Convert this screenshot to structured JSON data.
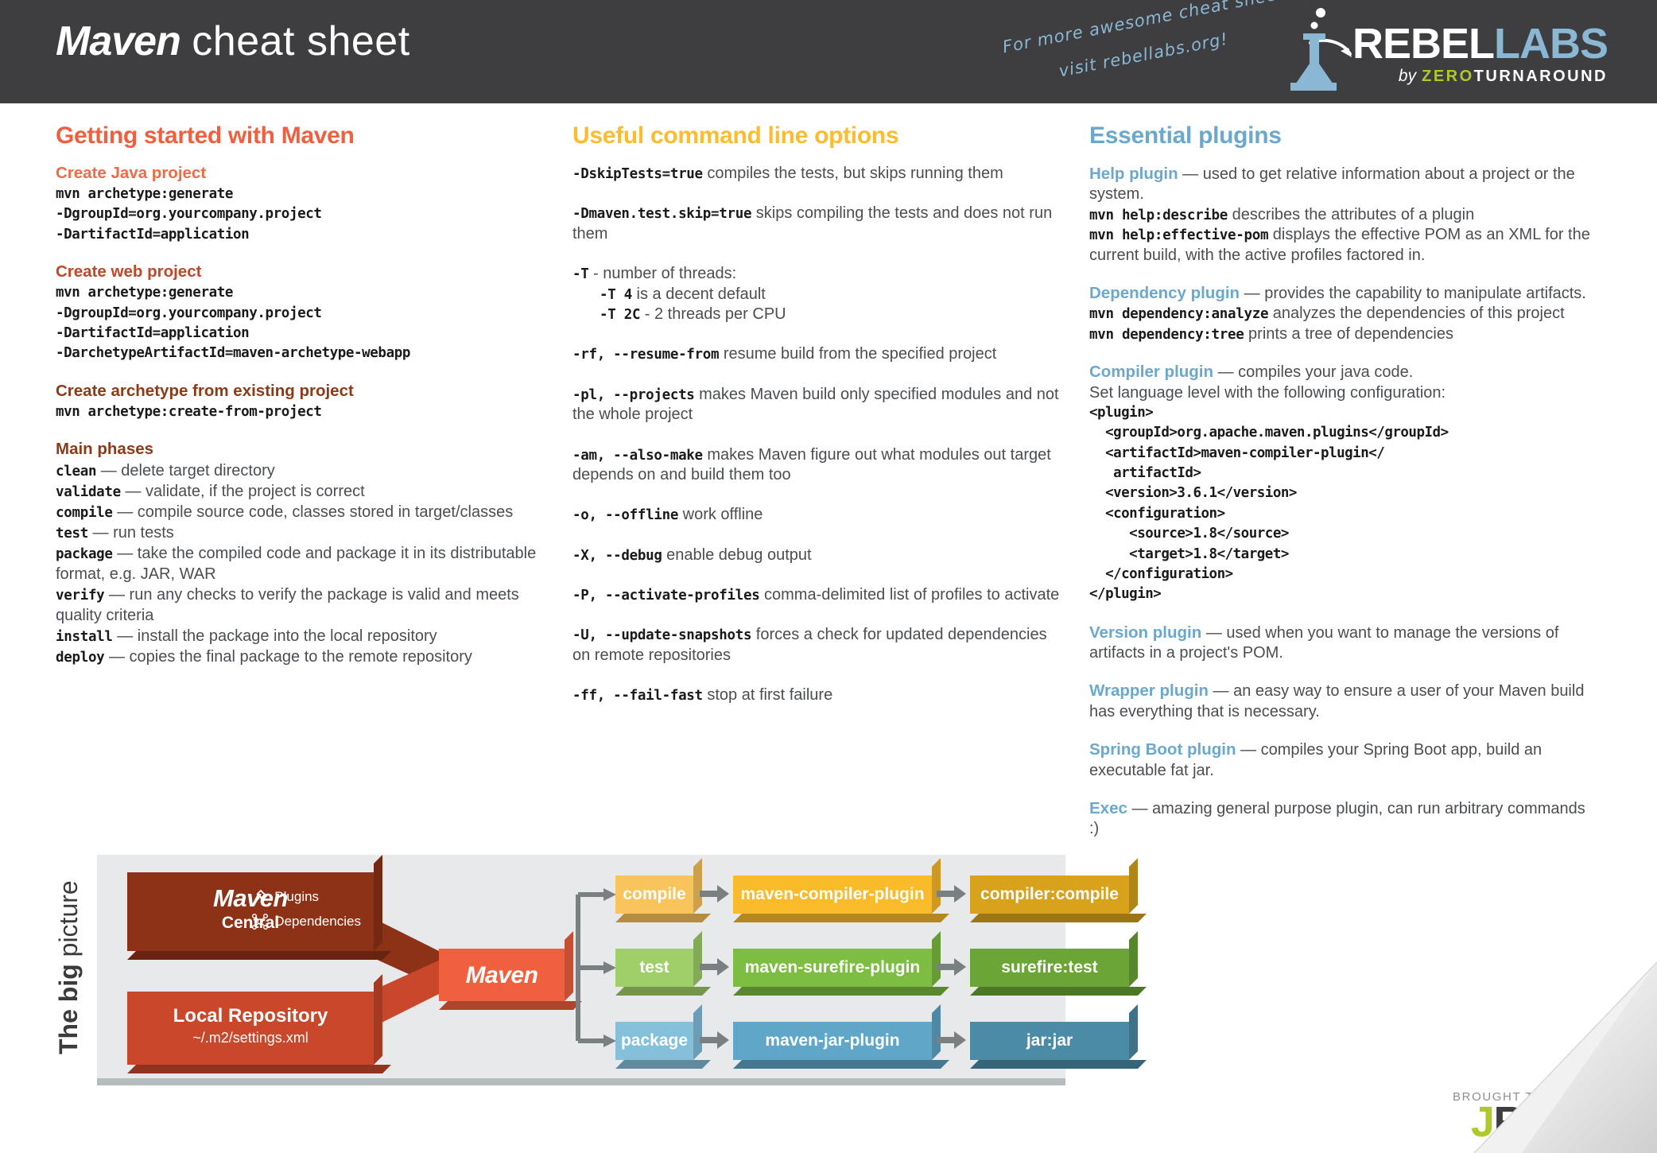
{
  "header": {
    "brand": "Maven",
    "subtitle": "cheat sheet",
    "promo_line1": "For more awesome cheat sheets",
    "promo_line2": "visit rebellabs.org!",
    "logo": {
      "rebel": "REBEL",
      "labs": "LABS",
      "by": "by",
      "zero": "ZERO",
      "turnaround": "TURNAROUND"
    },
    "colors": {
      "bar": "#3e3e40",
      "accent_blue": "#8ab8d4",
      "accent_green": "#aec92a"
    }
  },
  "columns": {
    "col1": {
      "title": "Getting started with Maven",
      "title_color": "#f0603f",
      "blocks": [
        {
          "heading": "Create Java project",
          "heading_color": "#ef6b43",
          "code": [
            "mvn archetype:generate",
            "-DgroupId=org.yourcompany.project",
            "-DartifactId=application"
          ]
        },
        {
          "heading": "Create web project",
          "heading_color": "#d1512d",
          "code": [
            "mvn archetype:generate",
            "-DgroupId=org.yourcompany.project",
            "-DartifactId=application",
            "-DarchetypeArtifactId=maven-archetype-webapp"
          ]
        },
        {
          "heading": "Create archetype from existing project",
          "heading_color": "#8c3b18",
          "code": [
            "mvn archetype:create-from-project"
          ]
        }
      ],
      "phases_heading": "Main phases",
      "phases_heading_color": "#8c3b18",
      "phases": [
        {
          "cmd": "clean",
          "desc": "— delete target directory"
        },
        {
          "cmd": "validate",
          "desc": "— validate, if the project is correct"
        },
        {
          "cmd": "compile",
          "desc": "— compile source code, classes stored in target/classes"
        },
        {
          "cmd": "test",
          "desc": "— run tests"
        },
        {
          "cmd": "package",
          "desc": "—  take the compiled code and package it in its distributable format, e.g. JAR, WAR"
        },
        {
          "cmd": "verify",
          "desc": "— run any checks to verify the package is valid and meets quality criteria"
        },
        {
          "cmd": "install",
          "desc": "—  install the package into the local repository"
        },
        {
          "cmd": "deploy",
          "desc": "— copies the final package to the remote repository"
        }
      ]
    },
    "col2": {
      "title": "Useful command line options",
      "title_color": "#fcbc2d",
      "options": [
        {
          "flag": "-DskipTests=true",
          "desc": "compiles the tests, but skips running them"
        },
        {
          "flag": "-Dmaven.test.skip=true",
          "desc": "skips compiling the tests and does not run them"
        },
        {
          "flag": "-T",
          "desc": "- number of threads:",
          "sub": [
            {
              "flag": "-T 4",
              "desc": "is a decent default"
            },
            {
              "flag": "-T 2C",
              "desc": "- 2 threads per CPU"
            }
          ]
        },
        {
          "flag": "-rf, --resume-from",
          "desc": "resume build from the specified project"
        },
        {
          "flag": "-pl, --projects",
          "desc": "makes Maven build only specified modules and not the whole project"
        },
        {
          "flag": "-am, --also-make",
          "desc": "makes Maven figure out what modules out target depends on and build them too"
        },
        {
          "flag": "-o, --offline",
          "desc": "work offline"
        },
        {
          "flag": "-X, --debug",
          "desc": "enable debug output"
        },
        {
          "flag": "-P, --activate-profiles",
          "desc": "comma-delimited list of profiles to activate"
        },
        {
          "flag": "-U, --update-snapshots",
          "desc": "forces a check for updated dependencies on remote repositories"
        },
        {
          "flag": "-ff, --fail-fast",
          "desc": "stop at first failure"
        }
      ]
    },
    "col3": {
      "title": "Essential plugins",
      "title_color": "#6aa8cc",
      "plugins": [
        {
          "name": "Help plugin",
          "desc": "— used to get relative information about a project or the system.",
          "lines": [
            {
              "code": "mvn help:describe",
              "text": "describes the attributes of a plugin"
            },
            {
              "code": "mvn help:effective-pom",
              "text": "displays the effective POM as an XML for the current build, with the active profiles factored in."
            }
          ]
        },
        {
          "name": "Dependency plugin",
          "desc": "— provides the capability to manipulate artifacts.",
          "lines": [
            {
              "code": "mvn dependency:analyze",
              "text": "analyzes the dependencies of this project"
            },
            {
              "code": "mvn dependency:tree",
              "text": "prints a tree of dependencies"
            }
          ]
        },
        {
          "name": "Compiler plugin",
          "desc": "— compiles your java code.",
          "extra": "Set language level with the following configuration:",
          "xml": [
            "<plugin>",
            "  <groupId>org.apache.maven.plugins</groupId>",
            "  <artifactId>maven-compiler-plugin</",
            "   artifactId>",
            "  <version>3.6.1</version>",
            "  <configuration>",
            "     <source>1.8</source>",
            "     <target>1.8</target>",
            "  </configuration>",
            "</plugin>"
          ]
        },
        {
          "name": "Version plugin",
          "desc": "— used when you want to manage the versions of artifacts in a project's POM."
        },
        {
          "name": "Wrapper plugin",
          "desc": "— an easy way to ensure a user of your Maven build has everything that is necessary."
        },
        {
          "name": "Spring Boot plugin",
          "desc": "— compiles your Spring Boot app, build an executable fat jar."
        },
        {
          "name": "Exec",
          "desc": "— amazing general purpose plugin, can run arbitrary commands :)"
        }
      ]
    }
  },
  "bigpicture": {
    "label_bold": "The big",
    "label_light": " picture",
    "maven_central": {
      "title": "Maven",
      "subtitle": "Central",
      "plugins_label": "Plugins",
      "dependencies_label": "Dependencies"
    },
    "local_repository": {
      "title": "Local Repository",
      "subtitle": "~/.m2/settings.xml"
    },
    "maven_core": "Maven",
    "rows": [
      {
        "phase": "compile",
        "plugin": "maven-compiler-plugin",
        "goal": "compiler:compile",
        "colors": {
          "phase": "#fac45c",
          "plugin": "#fabb2b",
          "goal": "#d9a21c"
        }
      },
      {
        "phase": "test",
        "plugin": "maven-surefire-plugin",
        "goal": "surefire:test",
        "colors": {
          "phase": "#a0cf69",
          "plugin": "#7cbd42",
          "goal": "#6aa536"
        }
      },
      {
        "phase": "package",
        "plugin": "maven-jar-plugin",
        "goal": "jar:jar",
        "colors": {
          "phase": "#85c0db",
          "plugin": "#5fa6c9",
          "goal": "#4b8ba6"
        }
      }
    ]
  },
  "footer": {
    "brought": "BROUGHT TO YOU BY",
    "jrebel_j": "J",
    "jrebel_rest": "Rebel"
  }
}
